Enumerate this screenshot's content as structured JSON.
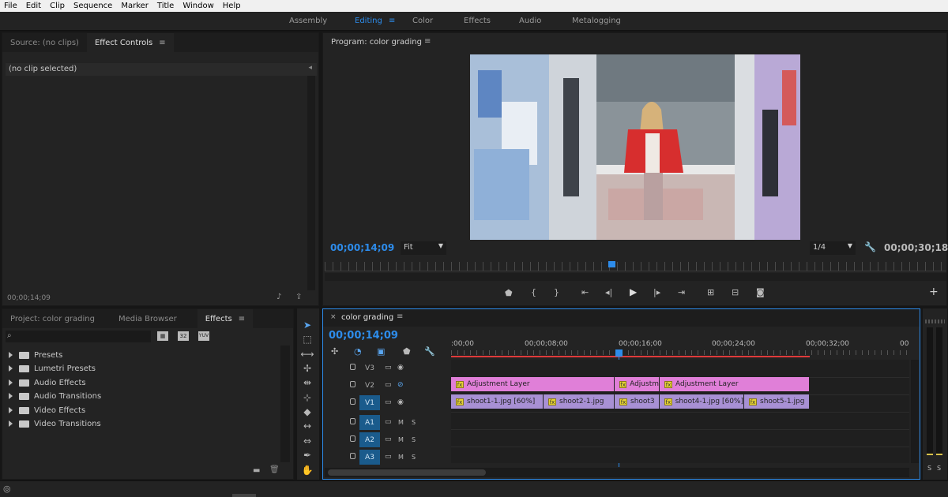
{
  "menu": [
    "File",
    "Edit",
    "Clip",
    "Sequence",
    "Marker",
    "Title",
    "Window",
    "Help"
  ],
  "workspaces": {
    "assembly": "Assembly",
    "editing": "Editing",
    "color": "Color",
    "effects": "Effects",
    "audio": "Audio",
    "metalogging": "Metalogging"
  },
  "source_panel": {
    "tab_source": "Source: (no clips)",
    "tab_effect_controls": "Effect Controls",
    "no_clip": "(no clip selected)",
    "timecode": "00;00;14;09"
  },
  "program_panel": {
    "title": "Program: color grading",
    "timecode": "00;00;14;09",
    "zoom": "Fit",
    "resolution": "1/4",
    "duration": "00;00;30;18"
  },
  "project_panel": {
    "tab_project": "Project: color grading",
    "tab_media_browser": "Media Browser",
    "tab_effects": "Effects",
    "badges": [
      "32",
      "YUV"
    ],
    "items": [
      "Presets",
      "Lumetri Presets",
      "Audio Effects",
      "Audio Transitions",
      "Video Effects",
      "Video Transitions"
    ]
  },
  "timeline": {
    "tab": "color grading",
    "timecode": "00;00;14;09",
    "ruler": [
      ":00;00",
      "00;00;08;00",
      "00;00;16;00",
      "00;00;24;00",
      "00;00;32;00",
      "00"
    ],
    "tracks": {
      "v3": "V3",
      "v2": "V2",
      "v1": "V1",
      "v1src": "V1",
      "a1": "A1",
      "a2": "A2",
      "a3": "A3",
      "a1src": "A1",
      "m": "M",
      "s": "S"
    },
    "v2_clips": [
      "Adjustment Layer",
      "Adjustm",
      "Adjustment Layer"
    ],
    "v1_clips": [
      "shoot1-1.jpg [60%]",
      "shoot2-1.jpg",
      "shoot3",
      "shoot4-1.jpg [60%]",
      "shoot5-1.jpg"
    ],
    "fx_label": "fx"
  },
  "meter_labels": [
    "S",
    "S"
  ],
  "colors": {
    "accent": "#2d8ceb",
    "adjustment": "#e07fd8",
    "clip": "#a890d4",
    "playhead": "#2d8ceb"
  }
}
